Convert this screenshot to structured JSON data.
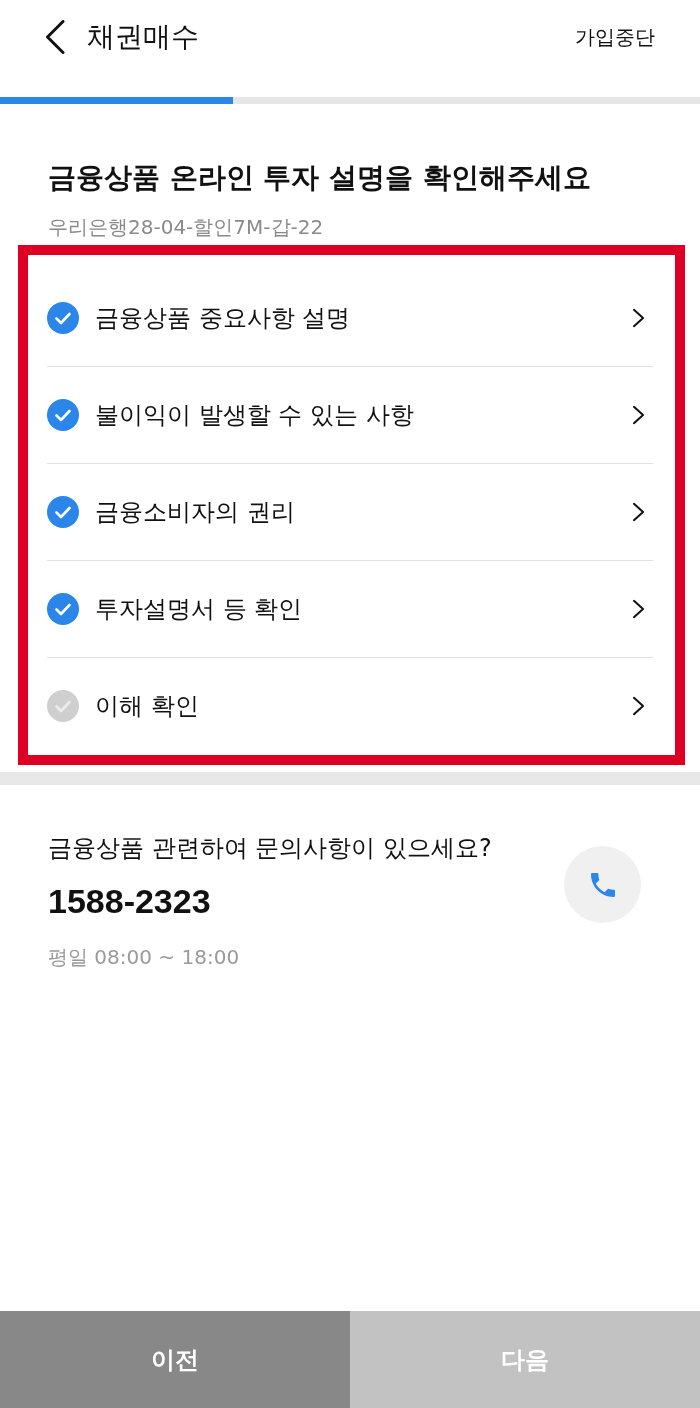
{
  "header": {
    "title": "채권매수",
    "action": "가입중단"
  },
  "progress": {
    "level": 0.333
  },
  "intro": {
    "title": "금융상품 온라인 투자 설명을 확인해주세요",
    "subtitle": "우리은행28-04-할인7M-갑-22"
  },
  "checklist": [
    {
      "label": "금융상품 중요사항 설명",
      "checked": true
    },
    {
      "label": "불이익이 발생할 수 있는 사항",
      "checked": true
    },
    {
      "label": "금융소비자의 권리",
      "checked": true
    },
    {
      "label": "투자설명서 등 확인",
      "checked": true
    },
    {
      "label": "이해 확인",
      "checked": false
    }
  ],
  "inquiry": {
    "question": "금융상품 관련하여 문의사항이 있으세요?",
    "phone": "1588-2323",
    "hours": "평일 08:00 ~ 18:00"
  },
  "buttons": [
    {
      "label": "이전",
      "disabled": false
    },
    {
      "label": "다음",
      "disabled": true
    }
  ]
}
